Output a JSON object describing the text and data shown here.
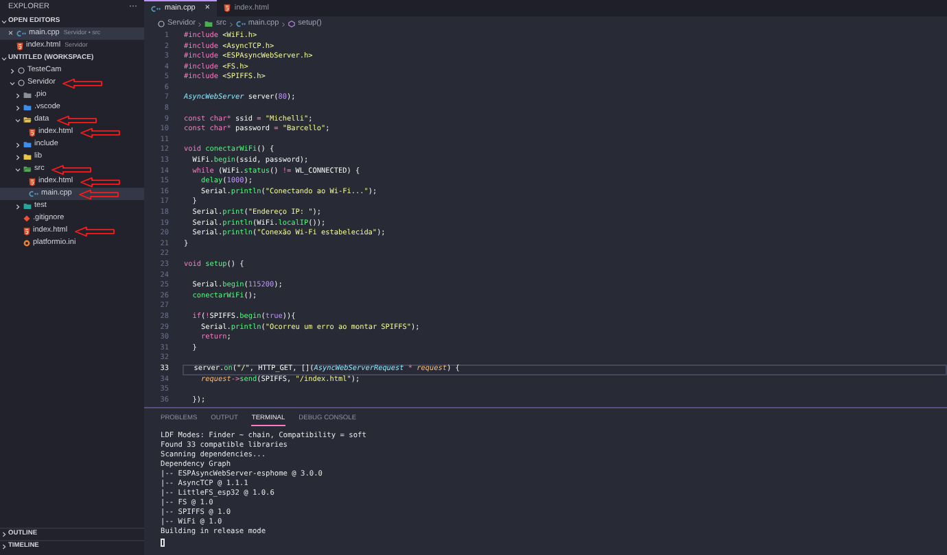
{
  "sidebar": {
    "title": "EXPLORER",
    "menu": "···",
    "open_editors": {
      "title": "OPEN EDITORS",
      "expanded": true,
      "items": [
        {
          "kind": "cpp",
          "name": "main.cpp",
          "description": "Servidor • src",
          "selected": true,
          "close": "×"
        },
        {
          "kind": "html",
          "name": "index.html",
          "description": "Servidor",
          "selected": false
        }
      ]
    },
    "workspace": {
      "title": "UNTITLED (WORKSPACE)",
      "expanded": true,
      "items": [
        {
          "kind": "root",
          "name": "TesteCam",
          "expanded": false,
          "selected": false,
          "marked": false
        },
        {
          "kind": "root",
          "name": "Servidor",
          "expanded": true,
          "selected": false,
          "marked": true,
          "children": [
            {
              "kind": "folder",
              "name": ".pio",
              "color": "#8a8f98",
              "expanded": false,
              "selected": false,
              "marked": false
            },
            {
              "kind": "folder",
              "name": ".vscode",
              "color": "#3b8eea",
              "expanded": false,
              "selected": false,
              "marked": false
            },
            {
              "kind": "folder",
              "name": "data",
              "color": "#e8c547",
              "expanded": true,
              "selected": false,
              "marked": true,
              "children": [
                {
                  "kind": "html",
                  "name": "index.html",
                  "selected": false,
                  "marked": true
                }
              ]
            },
            {
              "kind": "folder",
              "name": "include",
              "color": "#3b8eea",
              "expanded": false,
              "selected": false,
              "marked": false
            },
            {
              "kind": "folder",
              "name": "lib",
              "color": "#e8c547",
              "expanded": false,
              "selected": false,
              "marked": false
            },
            {
              "kind": "folder",
              "name": "src",
              "color": "#4caf50",
              "expanded": true,
              "selected": false,
              "marked": true,
              "children": [
                {
                  "kind": "html",
                  "name": "index.html",
                  "selected": false,
                  "marked": true
                },
                {
                  "kind": "cpp",
                  "name": "main.cpp",
                  "selected": true,
                  "marked": true
                }
              ]
            },
            {
              "kind": "folder",
              "name": "test",
              "color": "#26a69a",
              "expanded": false,
              "selected": false,
              "marked": false
            },
            {
              "kind": "gitignore",
              "name": ".gitignore",
              "selected": false,
              "marked": false
            },
            {
              "kind": "html",
              "name": "index.html",
              "selected": false,
              "marked": true
            },
            {
              "kind": "ini",
              "name": "platformio.ini",
              "selected": false,
              "marked": false
            }
          ]
        }
      ]
    },
    "bottom_sections": [
      {
        "title": "OUTLINE",
        "expanded": false
      },
      {
        "title": "TIMELINE",
        "expanded": false
      }
    ]
  },
  "tabs": [
    {
      "kind": "cpp",
      "label": "main.cpp",
      "selected": true,
      "close": "×"
    },
    {
      "kind": "html",
      "label": "index.html",
      "selected": false
    }
  ],
  "breadcrumb": [
    {
      "kind": "root",
      "label": "Servidor"
    },
    {
      "kind": "folder",
      "label": "src"
    },
    {
      "kind": "cpp",
      "label": "main.cpp"
    },
    {
      "kind": "function",
      "label": "setup()"
    }
  ],
  "editor": {
    "lines": [
      {
        "number": "1",
        "current": false,
        "tokens": [
          {
            "kind": "keyword",
            "text": "#include"
          },
          {
            "kind": "string",
            "text": " <WiFi.h>"
          }
        ]
      },
      {
        "number": "2",
        "current": false,
        "tokens": [
          {
            "kind": "keyword",
            "text": "#include"
          },
          {
            "kind": "string",
            "text": " <AsyncTCP.h>"
          }
        ]
      },
      {
        "number": "3",
        "current": false,
        "tokens": [
          {
            "kind": "keyword",
            "text": "#include"
          },
          {
            "kind": "string",
            "text": " <ESPAsyncWebServer.h>"
          }
        ]
      },
      {
        "number": "4",
        "current": false,
        "tokens": [
          {
            "kind": "keyword",
            "text": "#include"
          },
          {
            "kind": "string",
            "text": " <FS.h>"
          }
        ]
      },
      {
        "number": "5",
        "current": false,
        "tokens": [
          {
            "kind": "keyword",
            "text": "#include"
          },
          {
            "kind": "string",
            "text": " <SPIFFS.h>"
          }
        ]
      },
      {
        "number": "6",
        "current": false
      },
      {
        "number": "7",
        "current": false,
        "tokens": [
          {
            "kind": "type",
            "text": "AsyncWebServer"
          },
          {
            "kind": "plain",
            "text": " server("
          },
          {
            "kind": "number",
            "text": "80"
          },
          {
            "kind": "plain",
            "text": ");"
          }
        ]
      },
      {
        "number": "8",
        "current": false
      },
      {
        "number": "9",
        "current": false,
        "tokens": [
          {
            "kind": "keyword",
            "text": "const char*"
          },
          {
            "kind": "plain",
            "text": " ssid "
          },
          {
            "kind": "keyword",
            "text": "="
          },
          {
            "kind": "string",
            "text": " \"Michelli\""
          },
          {
            "kind": "plain",
            "text": ";"
          }
        ]
      },
      {
        "number": "10",
        "current": false,
        "tokens": [
          {
            "kind": "keyword",
            "text": "const char*"
          },
          {
            "kind": "plain",
            "text": " password "
          },
          {
            "kind": "keyword",
            "text": "="
          },
          {
            "kind": "string",
            "text": " \"Barcello\""
          },
          {
            "kind": "plain",
            "text": ";"
          }
        ]
      },
      {
        "number": "11",
        "current": false
      },
      {
        "number": "12",
        "current": false,
        "tokens": [
          {
            "kind": "keyword",
            "text": "void"
          },
          {
            "kind": "function",
            "text": " conectarWiFi"
          },
          {
            "kind": "plain",
            "text": "() {"
          }
        ]
      },
      {
        "number": "13",
        "current": false,
        "tokens": [
          {
            "kind": "plain",
            "text": "  WiFi."
          },
          {
            "kind": "function",
            "text": "begin"
          },
          {
            "kind": "plain",
            "text": "(ssid, password);"
          }
        ]
      },
      {
        "number": "14",
        "current": false,
        "tokens": [
          {
            "kind": "keyword",
            "text": "  while"
          },
          {
            "kind": "plain",
            "text": " (WiFi."
          },
          {
            "kind": "function",
            "text": "status"
          },
          {
            "kind": "plain",
            "text": "() "
          },
          {
            "kind": "keyword",
            "text": "!="
          },
          {
            "kind": "plain",
            "text": " WL_CONNECTED) {"
          }
        ]
      },
      {
        "number": "15",
        "current": false,
        "tokens": [
          {
            "kind": "function",
            "text": "    delay"
          },
          {
            "kind": "plain",
            "text": "("
          },
          {
            "kind": "number",
            "text": "1000"
          },
          {
            "kind": "plain",
            "text": ");"
          }
        ]
      },
      {
        "number": "16",
        "current": false,
        "tokens": [
          {
            "kind": "plain",
            "text": "    Serial."
          },
          {
            "kind": "function",
            "text": "println"
          },
          {
            "kind": "plain",
            "text": "("
          },
          {
            "kind": "string",
            "text": "\"Conectando ao Wi-Fi...\""
          },
          {
            "kind": "plain",
            "text": ");"
          }
        ]
      },
      {
        "number": "17",
        "current": false,
        "tokens": [
          {
            "kind": "plain",
            "text": "  }"
          }
        ]
      },
      {
        "number": "18",
        "current": false,
        "tokens": [
          {
            "kind": "plain",
            "text": "  Serial."
          },
          {
            "kind": "function",
            "text": "print"
          },
          {
            "kind": "plain",
            "text": "("
          },
          {
            "kind": "string",
            "text": "\"Endereço IP: \""
          },
          {
            "kind": "plain",
            "text": ");"
          }
        ]
      },
      {
        "number": "19",
        "current": false,
        "tokens": [
          {
            "kind": "plain",
            "text": "  Serial."
          },
          {
            "kind": "function",
            "text": "println"
          },
          {
            "kind": "plain",
            "text": "(WiFi."
          },
          {
            "kind": "function",
            "text": "localIP"
          },
          {
            "kind": "plain",
            "text": "());"
          }
        ]
      },
      {
        "number": "20",
        "current": false,
        "tokens": [
          {
            "kind": "plain",
            "text": "  Serial."
          },
          {
            "kind": "function",
            "text": "println"
          },
          {
            "kind": "plain",
            "text": "("
          },
          {
            "kind": "string",
            "text": "\"Conexão Wi-Fi estabelecida\""
          },
          {
            "kind": "plain",
            "text": ");"
          }
        ]
      },
      {
        "number": "21",
        "current": false,
        "tokens": [
          {
            "kind": "plain",
            "text": "}"
          }
        ]
      },
      {
        "number": "22",
        "current": false
      },
      {
        "number": "23",
        "current": false,
        "tokens": [
          {
            "kind": "keyword",
            "text": "void"
          },
          {
            "kind": "function",
            "text": " setup"
          },
          {
            "kind": "plain",
            "text": "() {"
          }
        ]
      },
      {
        "number": "24",
        "current": false
      },
      {
        "number": "25",
        "current": false,
        "tokens": [
          {
            "kind": "plain",
            "text": "  Serial."
          },
          {
            "kind": "function",
            "text": "begin"
          },
          {
            "kind": "plain",
            "text": "("
          },
          {
            "kind": "number",
            "text": "115200"
          },
          {
            "kind": "plain",
            "text": ");"
          }
        ]
      },
      {
        "number": "26",
        "current": false,
        "tokens": [
          {
            "kind": "function",
            "text": "  conectarWiFi"
          },
          {
            "kind": "plain",
            "text": "();"
          }
        ]
      },
      {
        "number": "27",
        "current": false
      },
      {
        "number": "28",
        "current": false,
        "tokens": [
          {
            "kind": "keyword",
            "text": "  if"
          },
          {
            "kind": "plain",
            "text": "("
          },
          {
            "kind": "keyword",
            "text": "!"
          },
          {
            "kind": "plain",
            "text": "SPIFFS."
          },
          {
            "kind": "function",
            "text": "begin"
          },
          {
            "kind": "plain",
            "text": "("
          },
          {
            "kind": "number",
            "text": "true"
          },
          {
            "kind": "plain",
            "text": ")){"
          }
        ]
      },
      {
        "number": "29",
        "current": false,
        "tokens": [
          {
            "kind": "plain",
            "text": "    Serial."
          },
          {
            "kind": "function",
            "text": "println"
          },
          {
            "kind": "plain",
            "text": "("
          },
          {
            "kind": "string",
            "text": "\"Ocorreu um erro ao montar SPIFFS\""
          },
          {
            "kind": "plain",
            "text": ");"
          }
        ]
      },
      {
        "number": "30",
        "current": false,
        "tokens": [
          {
            "kind": "keyword",
            "text": "    return"
          },
          {
            "kind": "plain",
            "text": ";"
          }
        ]
      },
      {
        "number": "31",
        "current": false,
        "tokens": [
          {
            "kind": "plain",
            "text": "  }"
          }
        ]
      },
      {
        "number": "32",
        "current": false
      },
      {
        "number": "33",
        "current": true,
        "tokens": [
          {
            "kind": "plain",
            "text": "  server."
          },
          {
            "kind": "function",
            "text": "on"
          },
          {
            "kind": "plain",
            "text": "("
          },
          {
            "kind": "string",
            "text": "\"/\""
          },
          {
            "kind": "plain",
            "text": ", HTTP_GET, []("
          },
          {
            "kind": "type",
            "text": "AsyncWebServerRequest"
          },
          {
            "kind": "keyword",
            "text": " *"
          },
          {
            "kind": "param",
            "text": " request"
          },
          {
            "kind": "plain",
            "text": ") {"
          }
        ]
      },
      {
        "number": "34",
        "current": false,
        "tokens": [
          {
            "kind": "param",
            "text": "    request"
          },
          {
            "kind": "keyword",
            "text": "->"
          },
          {
            "kind": "function",
            "text": "send"
          },
          {
            "kind": "plain",
            "text": "(SPIFFS, "
          },
          {
            "kind": "string",
            "text": "\"/index.html\""
          },
          {
            "kind": "plain",
            "text": ");"
          }
        ]
      },
      {
        "number": "35",
        "current": false
      },
      {
        "number": "36",
        "current": false,
        "tokens": [
          {
            "kind": "plain",
            "text": "  });"
          }
        ]
      }
    ]
  },
  "panel": {
    "tabs": [
      {
        "label": "PROBLEMS",
        "selected": false
      },
      {
        "label": "OUTPUT",
        "selected": false
      },
      {
        "label": "TERMINAL",
        "selected": true
      },
      {
        "label": "DEBUG CONSOLE",
        "selected": false
      }
    ],
    "terminal_lines": [
      "LDF Modes: Finder ~ chain, Compatibility = soft",
      "Found 33 compatible libraries",
      "Scanning dependencies...",
      "Dependency Graph",
      "|-- ESPAsyncWebServer-esphome @ 3.0.0",
      "|-- AsyncTCP @ 1.1.1",
      "|-- LittleFS_esp32 @ 1.0.6",
      "|-- FS @ 1.0",
      "|-- SPIFFS @ 1.0",
      "|-- WiFi @ 1.0",
      "Building in release mode"
    ]
  }
}
